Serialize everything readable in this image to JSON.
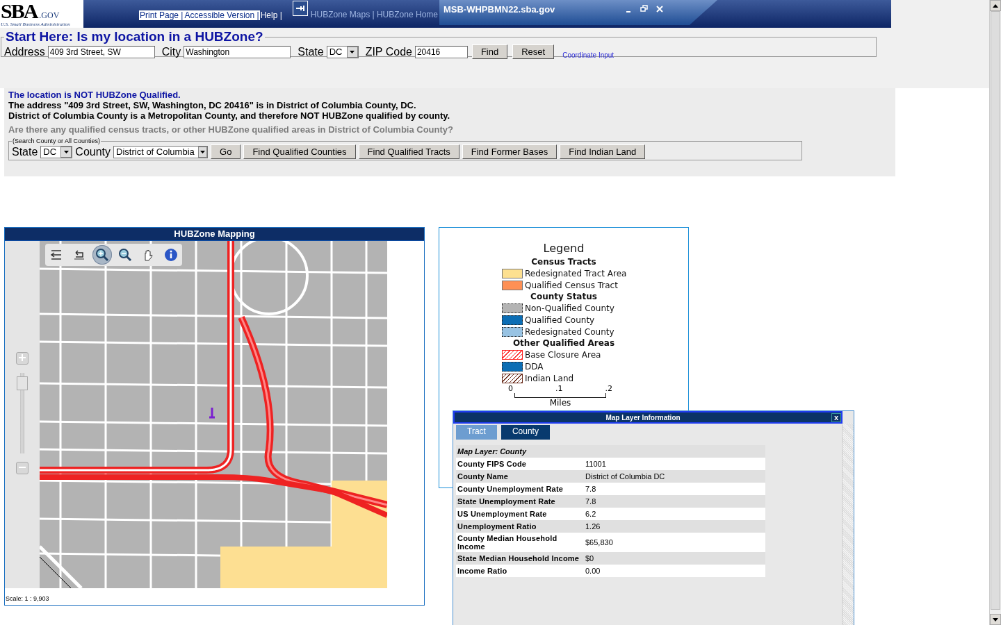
{
  "header": {
    "logo": "SBA",
    "logo_suffix": ".GOV",
    "tagline": "U.S. Small Business Administration",
    "nav_links": [
      {
        "label": "Print Page |",
        "highlighted": true
      },
      {
        "label": "Accessible Version |",
        "highlighted": true
      },
      {
        "label": "Help |",
        "highlighted": false
      }
    ],
    "faded_links": "HUBZone Maps | HUBZone Home",
    "window_title": "MSB-WHPBMN22.sba.gov"
  },
  "search_form": {
    "legend": "Start Here: Is my location in a HUBZone?",
    "fields": [
      {
        "label": "Address",
        "value": "409 3rd Street, SW",
        "kind": "text"
      },
      {
        "label": "City",
        "value": "Washington",
        "kind": "text"
      },
      {
        "label": "State",
        "value": "DC",
        "kind": "select"
      },
      {
        "label": "ZIP Code",
        "value": "20416",
        "kind": "text"
      }
    ],
    "buttons": [
      "Find",
      "Reset"
    ],
    "link": "Coordinate Input"
  },
  "result": {
    "headline": "The location is NOT HUBZone Qualified.",
    "lines": [
      "The address \"409 3rd Street, SW, Washington, DC 20416\" is in District of Columbia County, DC.",
      "District of Columbia County is a Metropolitan County, and therefore NOT HUBZone qualified by county."
    ],
    "question": "Are there any qualified census tracts, or other HUBZone qualified areas in District of Columbia County?"
  },
  "county_search": {
    "legend": "(Search County or All Counties)",
    "fields": [
      {
        "label": "State",
        "value": "DC"
      },
      {
        "label": "County",
        "value": "District of Columbia"
      }
    ],
    "buttons": [
      "Go",
      "Find Qualified Counties",
      "Find Qualified Tracts",
      "Find Former Bases",
      "Find Indian Land"
    ]
  },
  "map": {
    "title": "HUBZone Mapping",
    "tools": [
      {
        "kind": "full-extent",
        "selected": false
      },
      {
        "kind": "back",
        "selected": false
      },
      {
        "kind": "zoom-in",
        "selected": true
      },
      {
        "kind": "zoom-out",
        "selected": false
      },
      {
        "kind": "pan",
        "selected": false
      },
      {
        "kind": "info",
        "selected": false
      }
    ],
    "zoom": {
      "level": 0.95
    },
    "scale": "Scale: 1 : 9,903"
  },
  "legend": {
    "title": "Legend",
    "sections": [
      {
        "heading": "Census Tracts",
        "items": [
          {
            "label": "Redesignated Tract Area",
            "color": "#fde090",
            "kind": "solid"
          },
          {
            "label": "Qualified Census Tract",
            "color": "#fe9055",
            "kind": "solid"
          }
        ]
      },
      {
        "heading": "County Status",
        "items": [
          {
            "label": "Non-Qualified County",
            "color": "#b4b4b4",
            "kind": "dotted"
          },
          {
            "label": "Qualified County",
            "color": "#0b6db4",
            "kind": "dotted"
          },
          {
            "label": "Redesignated County",
            "color": "#98c3e3",
            "kind": "dotted"
          }
        ]
      },
      {
        "heading": "Other Qualified Areas",
        "items": [
          {
            "label": "Base Closure Area",
            "color": "#ff2020",
            "kind": "hatch"
          },
          {
            "label": "DDA",
            "color": "#0b6db4",
            "kind": "dotted"
          },
          {
            "label": "Indian Land",
            "color": "#6b2e1e",
            "kind": "hatch"
          }
        ]
      }
    ],
    "scale_ticks": [
      "0",
      ".1",
      ".2"
    ],
    "scale_unit": "Miles"
  },
  "info_popup": {
    "title": "Map Layer Information",
    "close": "x",
    "tabs": [
      {
        "label": "Tract",
        "selected": false
      },
      {
        "label": "County",
        "selected": true
      }
    ],
    "layer_heading": "Map Layer: County",
    "rows": [
      {
        "label": "County FIPS Code",
        "value": "11001"
      },
      {
        "label": "County Name",
        "value": "District of Columbia DC"
      },
      {
        "label": "County Unemployment Rate",
        "value": "7.8"
      },
      {
        "label": "State Unemployment Rate",
        "value": "7.8"
      },
      {
        "label": "US Unemployment Rate",
        "value": "6.2"
      },
      {
        "label": "Unemployment Ratio",
        "value": "1.26"
      },
      {
        "label": "County Median Household Income",
        "value": "$65,830"
      },
      {
        "label": "State Median Household Income",
        "value": "$0"
      },
      {
        "label": "Income Ratio",
        "value": "0.00"
      }
    ]
  }
}
